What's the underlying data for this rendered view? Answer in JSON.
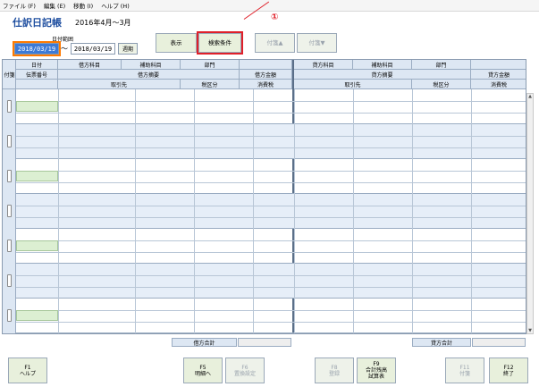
{
  "menu": [
    "ファイル (F)",
    "編集 (E)",
    "移動 (I)",
    "ヘルプ (H)"
  ],
  "title": "仕訳日記帳",
  "period": "2016年4月～3月",
  "date_range": {
    "label": "日付範囲",
    "from": "2018/03/19",
    "tilde": "～",
    "to": "2018/03/19",
    "week_button": "週期"
  },
  "toolbar": {
    "display": "表示",
    "search": "検索条件",
    "fusen_up": "付箋▲",
    "fusen_down": "付箋▼"
  },
  "annotation": "①",
  "header": {
    "fusen": "付箋",
    "left": {
      "date": "日付",
      "voucher": "伝票番号",
      "account": "借方科目",
      "sub_account": "補助科目",
      "department": "部門",
      "summary": "借方摘要",
      "amount": "借方金額",
      "partner": "取引先",
      "tax_class": "税区分",
      "tax": "消費税"
    },
    "right": {
      "account": "貸方科目",
      "sub_account": "補助科目",
      "department": "部門",
      "summary": "貸方摘要",
      "amount": "貸方金額",
      "partner": "取引先",
      "tax_class": "税区分",
      "tax": "消費税"
    }
  },
  "totals": {
    "debit_label": "借方合計",
    "credit_label": "貸方合計"
  },
  "fkeys": [
    {
      "key": "F1",
      "label": "ヘルプ"
    },
    {
      "key": "F5",
      "label": "明細へ"
    },
    {
      "key": "F6",
      "label": "置換設定"
    },
    {
      "key": "F8",
      "label": "登録"
    },
    {
      "key": "F9",
      "label": "合計残高",
      "label2": "試算表"
    },
    {
      "key": "F11",
      "label": "付箋"
    },
    {
      "key": "F12",
      "label": "終了"
    }
  ]
}
